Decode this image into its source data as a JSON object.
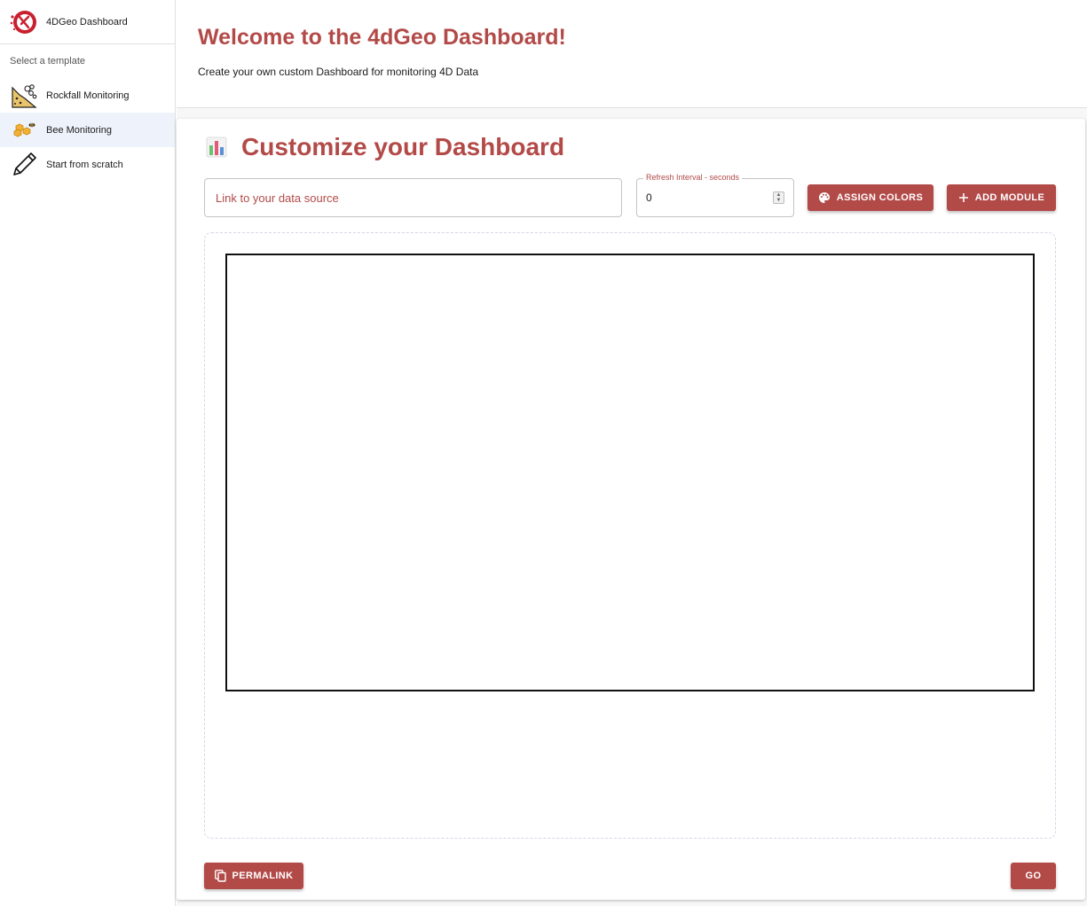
{
  "sidebar": {
    "app_title": "4DGeo Dashboard",
    "section_label": "Select a template",
    "items": [
      {
        "label": "Rockfall Monitoring",
        "icon": "rockfall-icon",
        "selected": false
      },
      {
        "label": "Bee Monitoring",
        "icon": "bee-icon",
        "selected": true
      },
      {
        "label": "Start from scratch",
        "icon": "pencil-icon",
        "selected": false
      }
    ]
  },
  "welcome": {
    "title": "Welcome to the 4dGeo Dashboard!",
    "subtitle": "Create your own custom Dashboard for monitoring 4D Data"
  },
  "card": {
    "title": "Customize your Dashboard",
    "title_icon": "bar-chart-icon",
    "datasource_placeholder": "Link to your data source",
    "refresh_label": "Refresh Interval - seconds",
    "refresh_value": "0",
    "assign_colors_label": "ASSIGN COLORS",
    "add_module_label": "ADD MODULE",
    "permalink_label": "PERMALINK",
    "go_label": "GO"
  },
  "colors": {
    "accent": "#b24a48",
    "selected_bg": "#eef3fb"
  }
}
